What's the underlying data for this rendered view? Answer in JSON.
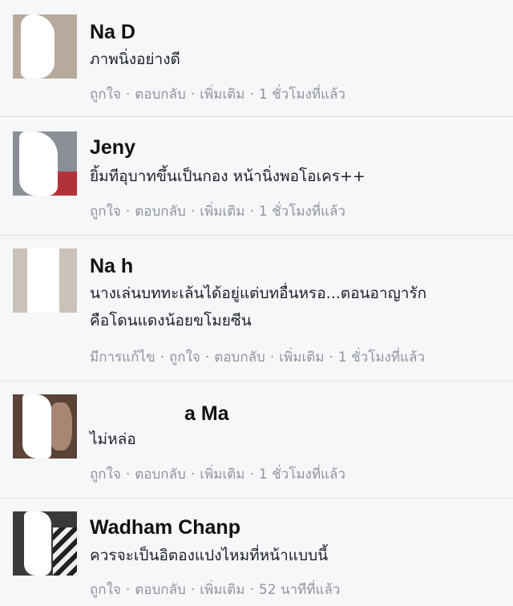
{
  "comments": [
    {
      "name": "Na  Dun",
      "text_lines": [
        "ภาพนิ่งอย่างดี"
      ],
      "edited_label": "",
      "like": "ถูกใจ",
      "reply": "ตอบกลับ",
      "more": "เพิ่มเติม",
      "time": "1 ชั่วโมงที่แล้ว"
    },
    {
      "name": "Jeny",
      "text_lines": [
        "ยิ้มทีอุบาทขึ้นเป็นกอง หน้านิ่งพอโอเคร++"
      ],
      "edited_label": "",
      "like": "ถูกใจ",
      "reply": "ตอบกลับ",
      "more": "เพิ่มเติม",
      "time": "1 ชั่วโมงที่แล้ว"
    },
    {
      "name": "Na  ha",
      "text_lines": [
        "นางเล่นบททะเล้นได้อยู่แต่บทอื่นหรอ...ตอนอาญารัก",
        "คือโดนแดงน้อยขโมยซีน"
      ],
      "edited_label": "มีการแก้ไข",
      "like": "ถูกใจ",
      "reply": "ตอบกลับ",
      "more": "เพิ่มเติม",
      "time": "1 ชั่วโมงที่แล้ว"
    },
    {
      "name": "a Ma",
      "text_lines": [
        "ไม่หล่อ"
      ],
      "edited_label": "",
      "like": "ถูกใจ",
      "reply": "ตอบกลับ",
      "more": "เพิ่มเติม",
      "time": "1 ชั่วโมงที่แล้ว"
    },
    {
      "name": "Wadham Chanp",
      "text_lines": [
        "ควรจะเป็นอิตองแปงไหมที่หน้าแบบนี้"
      ],
      "edited_label": "",
      "like": "ถูกใจ",
      "reply": "ตอบกลับ",
      "more": "เพิ่มเติม",
      "time": "52 นาทีที่แล้ว"
    }
  ],
  "separator": "·",
  "colors": {
    "background": "#f6f7f9",
    "name": "#111111",
    "text": "#1d2129",
    "meta": "#90949c",
    "divider": "#dcdee3"
  }
}
